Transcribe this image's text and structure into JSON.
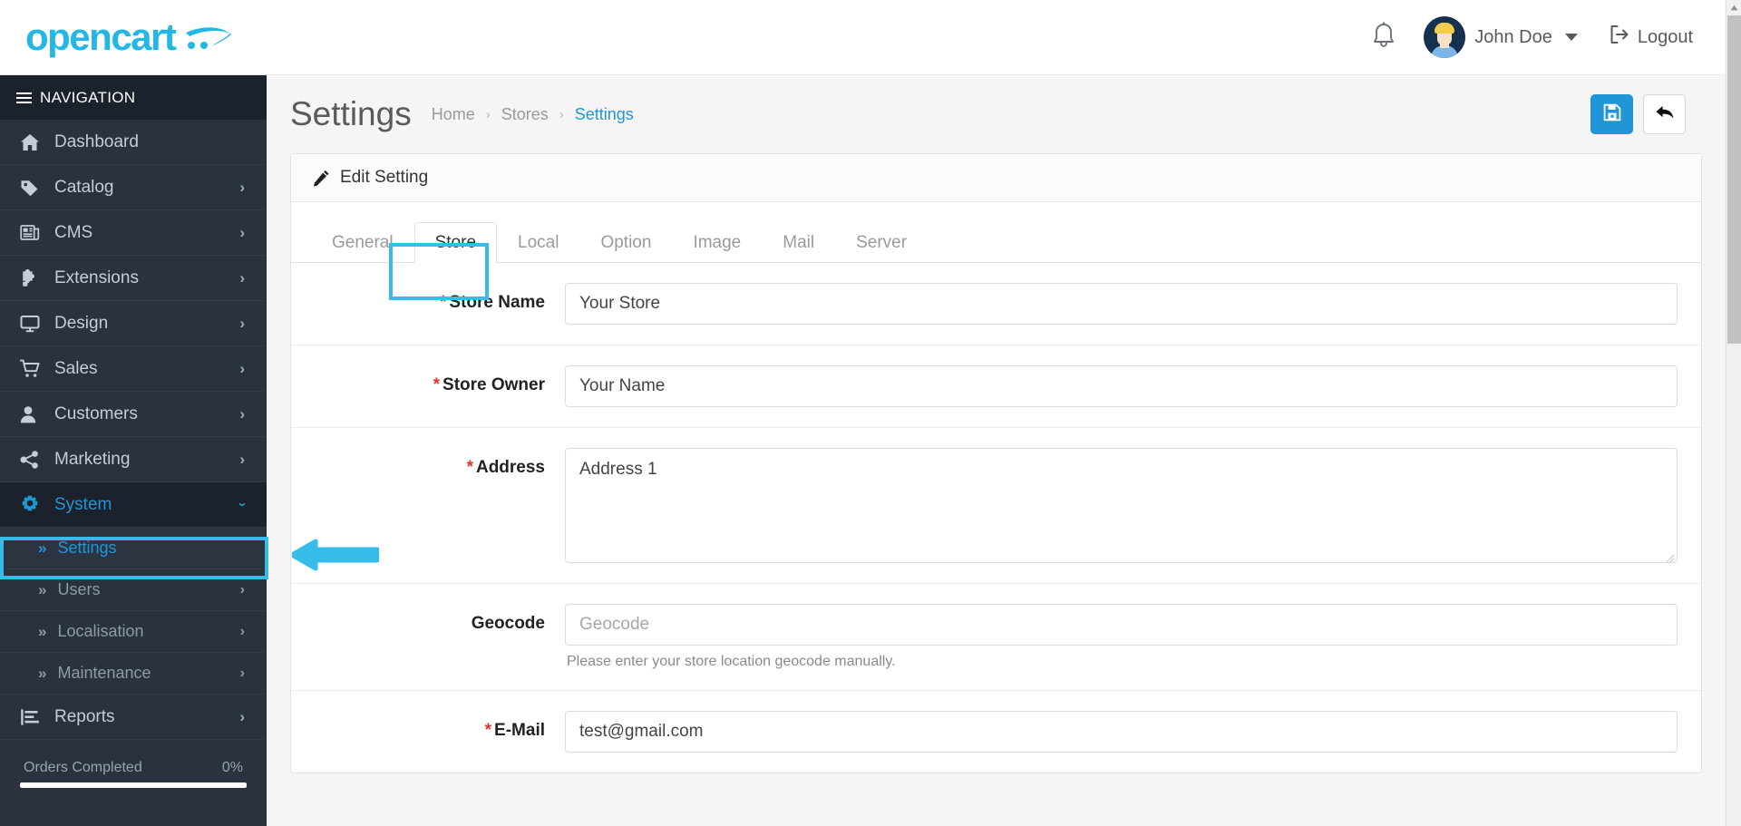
{
  "header": {
    "logo_text": "opencart",
    "logo_icon": "shopping-cart-swoosh-icon",
    "notification_icon": "bell-icon",
    "user_name": "John Doe",
    "user_caret_icon": "chevron-down-icon",
    "logout_label": "Logout",
    "logout_icon": "logout-icon",
    "avatar_icon": "user-avatar"
  },
  "sidebar": {
    "nav_title": "NAVIGATION",
    "menu_icon": "hamburger-icon",
    "items": [
      {
        "label": "Dashboard",
        "icon": "home-icon",
        "has_children": false,
        "state": "normal"
      },
      {
        "label": "Catalog",
        "icon": "tag-icon",
        "has_children": true,
        "state": "normal"
      },
      {
        "label": "CMS",
        "icon": "newspaper-icon",
        "has_children": true,
        "state": "normal"
      },
      {
        "label": "Extensions",
        "icon": "puzzle-piece-icon",
        "has_children": true,
        "state": "normal"
      },
      {
        "label": "Design",
        "icon": "desktop-icon",
        "has_children": true,
        "state": "normal"
      },
      {
        "label": "Sales",
        "icon": "shopping-cart-icon",
        "has_children": true,
        "state": "normal"
      },
      {
        "label": "Customers",
        "icon": "user-icon",
        "has_children": true,
        "state": "normal"
      },
      {
        "label": "Marketing",
        "icon": "share-nodes-icon",
        "has_children": true,
        "state": "normal"
      },
      {
        "label": "System",
        "icon": "gear-icon",
        "has_children": true,
        "state": "open"
      }
    ],
    "system_submenu": [
      {
        "label": "Settings",
        "icon": "angles-right-icon",
        "has_children": false,
        "state": "active"
      },
      {
        "label": "Users",
        "icon": "angles-right-icon",
        "has_children": true,
        "state": "normal"
      },
      {
        "label": "Localisation",
        "icon": "angles-right-icon",
        "has_children": true,
        "state": "normal"
      },
      {
        "label": "Maintenance",
        "icon": "angles-right-icon",
        "has_children": true,
        "state": "normal"
      }
    ],
    "items_after": [
      {
        "label": "Reports",
        "icon": "chart-bar-icon",
        "has_children": true,
        "state": "normal"
      }
    ],
    "progress": {
      "label": "Orders Completed",
      "value_text": "0%",
      "percent": 100
    }
  },
  "page": {
    "title": "Settings",
    "breadcrumb": [
      {
        "label": "Home",
        "current": false
      },
      {
        "label": "Stores",
        "current": false
      },
      {
        "label": "Settings",
        "current": true
      }
    ],
    "breadcrumb_separator": "›",
    "save_button_icon": "floppy-disk-save-icon",
    "back_button_icon": "back-arrow-icon"
  },
  "panel": {
    "heading": "Edit Setting",
    "heading_icon": "pencil-icon",
    "tabs": [
      {
        "label": "General",
        "active": false
      },
      {
        "label": "Store",
        "active": true
      },
      {
        "label": "Local",
        "active": false
      },
      {
        "label": "Option",
        "active": false
      },
      {
        "label": "Image",
        "active": false
      },
      {
        "label": "Mail",
        "active": false
      },
      {
        "label": "Server",
        "active": false
      }
    ]
  },
  "form": {
    "fields": [
      {
        "label": "Store Name",
        "required": true,
        "type": "text",
        "value": "Your Store",
        "placeholder": "Store Name",
        "is_placeholder": false,
        "help": ""
      },
      {
        "label": "Store Owner",
        "required": true,
        "type": "text",
        "value": "Your Name",
        "placeholder": "Store Owner",
        "is_placeholder": false,
        "help": ""
      },
      {
        "label": "Address",
        "required": true,
        "type": "textarea",
        "value": "Address 1",
        "placeholder": "Address",
        "is_placeholder": false,
        "help": ""
      },
      {
        "label": "Geocode",
        "required": false,
        "type": "text",
        "value": "Geocode",
        "placeholder": "Geocode",
        "is_placeholder": true,
        "help": "Please enter your store location geocode manually."
      },
      {
        "label": "E-Mail",
        "required": true,
        "type": "text",
        "value": "test@gmail.com",
        "placeholder": "E-Mail",
        "is_placeholder": false,
        "help": ""
      }
    ]
  },
  "annotations": {
    "highlight_color": "#36bce8",
    "settings_menu_box": true,
    "store_tab_box": true,
    "pointer_arrow": "left-arrow-annotation"
  },
  "scrollbar": {
    "up_arrow_icon": "scroll-up-arrow-icon",
    "track_color": "#f1f1f1",
    "thumb_color": "#c1c1c1"
  }
}
